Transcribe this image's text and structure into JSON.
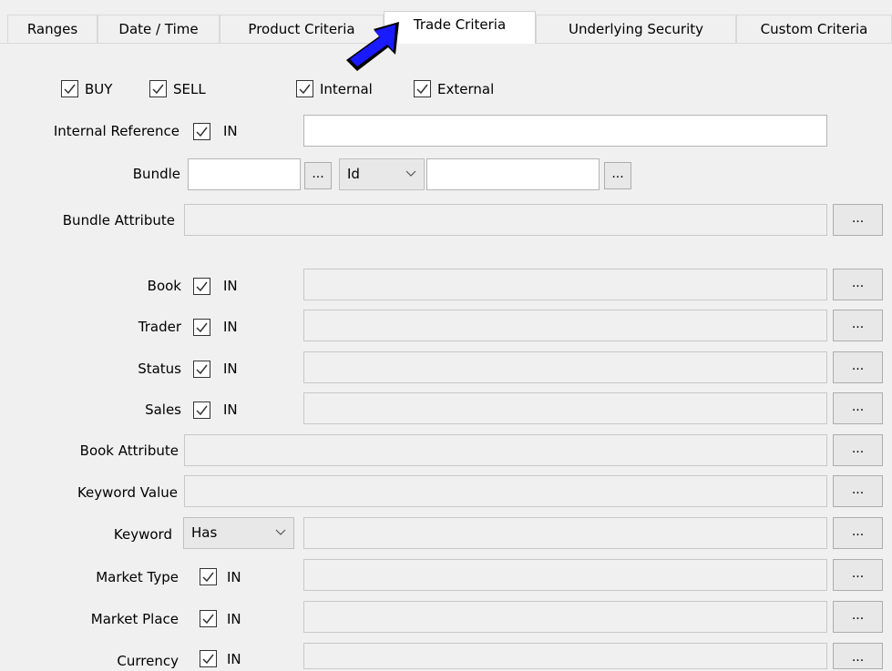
{
  "tabs": [
    "Ranges",
    "Date / Time",
    "Product Criteria",
    "Trade Criteria",
    "Underlying Security",
    "Custom Criteria"
  ],
  "active_tab": "Trade Criteria",
  "top_checks": {
    "buy": "BUY",
    "sell": "SELL",
    "internal": "Internal",
    "external": "External"
  },
  "in_label": "IN",
  "dots_label": "...",
  "labels": {
    "internal_reference": "Internal Reference",
    "bundle": "Bundle",
    "bundle_attribute": "Bundle Attribute",
    "book": "Book",
    "trader": "Trader",
    "status": "Status",
    "sales": "Sales",
    "book_attribute": "Book Attribute",
    "keyword_value": "Keyword Value",
    "keyword": "Keyword",
    "market_type": "Market Type",
    "market_place": "Market Place",
    "currency": "Currency"
  },
  "bundle_select": "Id",
  "keyword_select": "Has",
  "pointer_color": "#1a1aff"
}
